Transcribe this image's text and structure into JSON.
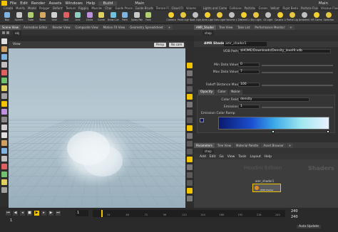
{
  "menubar": {
    "items": [
      "File",
      "Edit",
      "Render",
      "Assets",
      "Windows",
      "Help"
    ],
    "build": "Build",
    "main": "Main",
    "main2": "Main"
  },
  "shelf_tabs": [
    "Create",
    "Modify",
    "Model",
    "Polygon",
    "Deform",
    "Texture",
    "Rigging",
    "Muscles",
    "Char",
    "Guide Process",
    "Guide Brushes",
    "Terrain FX",
    "Cloud FX",
    "Volume"
  ],
  "shelf_tabs_right": [
    "Lights and Cameras",
    "Collisions",
    "Particles",
    "Grains",
    "Vellum",
    "Rigid Bodies",
    "Particle Fluids",
    "Viscous Fluids",
    "Oceans",
    "Fluid Containers",
    "Populate Containers",
    "Container Tools",
    "Pyro FX",
    "FEM",
    "Wires",
    "Crowds",
    "Drive Simulation"
  ],
  "shelf_tools_left": [
    "Box",
    "Sphere",
    "Tube",
    "Torus",
    "Grid",
    "Null",
    "Line",
    "Circle",
    "Curve",
    "Draw Curve",
    "Path",
    "Spray Paint",
    "Font",
    "Platonic",
    "L-System",
    "Metaball",
    "File"
  ],
  "shelf_tools_right": [
    "Camera",
    "Point Light",
    "Spot Light",
    "Area Light",
    "Geo Light",
    "Volume Light",
    "Distant Light",
    "Sky Light",
    "GI Light",
    "Caustic Light",
    "Portal Light",
    "Ambient Light",
    "VR Camera",
    "Switcher",
    "Gamepad Camera"
  ],
  "left_tabs": [
    "Scene View",
    "Animation Editor",
    "Render View",
    "Composite View",
    "Motion FX View",
    "Geometry Spreadsheet",
    "+"
  ],
  "left_path": "obj",
  "viewport": {
    "title": "View",
    "persp": "Persp",
    "cam": "No cam"
  },
  "right_tabs": [
    "AMR_Shader",
    "Tree View",
    "Take List",
    "Performance Monitor",
    "+"
  ],
  "right_path": "shop",
  "node_header": {
    "type": "AMR Shader",
    "name": "amr_shader1"
  },
  "parms": {
    "vdb_path_label": "VDB Path",
    "vdb_path": "$HOME/Downloads/Density_level9.vdb",
    "min_label": "Min Data Value",
    "min_value": "0",
    "max_label": "Max Data Value",
    "max_value": "7",
    "falloff_label": "Falloff Distance Max",
    "falloff_value": "100",
    "tabs": [
      "Opacity",
      "Color",
      "Noise"
    ],
    "color_field_label": "Color Field",
    "color_field_value": "density",
    "emission_label": "Emission",
    "emission_value": "1",
    "ramp_label": "Emission Color Ramp"
  },
  "network": {
    "tabs": [
      "Parameters",
      "Tree View",
      "Material Palette",
      "Asset Browser",
      "+"
    ],
    "path": "shop",
    "menu": [
      "Add",
      "Edit",
      "Go",
      "View",
      "Tools",
      "Layout",
      "Help"
    ],
    "watermark1": "Houdini Edition",
    "watermark2": "Shaders",
    "node_name": "amr_shader1",
    "node_type": "AMR Shader"
  },
  "timeline": {
    "frame": "1",
    "start": "1",
    "end": "240",
    "end2": "240",
    "ticks": [
      "24",
      "48",
      "72",
      "96",
      "120",
      "144",
      "168",
      "192",
      "216",
      "240"
    ],
    "auto_update": "Auto Update"
  },
  "colors": {
    "accent": "#f2c400",
    "ramp_start": "#0a1a6e",
    "ramp_end": "#e8f0ff"
  }
}
